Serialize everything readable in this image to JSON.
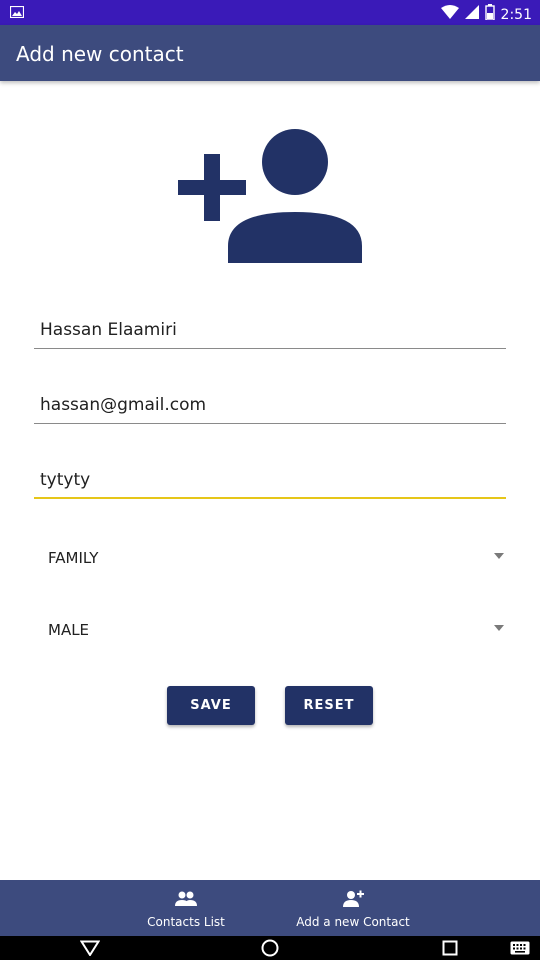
{
  "status_bar": {
    "time": "2:51"
  },
  "app_bar": {
    "title": "Add new contact"
  },
  "form": {
    "name_value": "Hassan Elaamiri",
    "email_value": "hassan@gmail.com",
    "phone_value": "tytyty",
    "category_selected": "FAMILY",
    "gender_selected": "MALE",
    "save_label": "SAVE",
    "reset_label": "RESET"
  },
  "bottom_nav": {
    "items": [
      {
        "label": "Contacts List",
        "icon": "people-icon"
      },
      {
        "label": "Add a new Contact",
        "icon": "person-add-icon"
      }
    ]
  },
  "colors": {
    "status_bar": "#3a1ab8",
    "primary": "#3d4b7e",
    "accent_dark": "#223266",
    "focus_underline": "#e6c619"
  }
}
